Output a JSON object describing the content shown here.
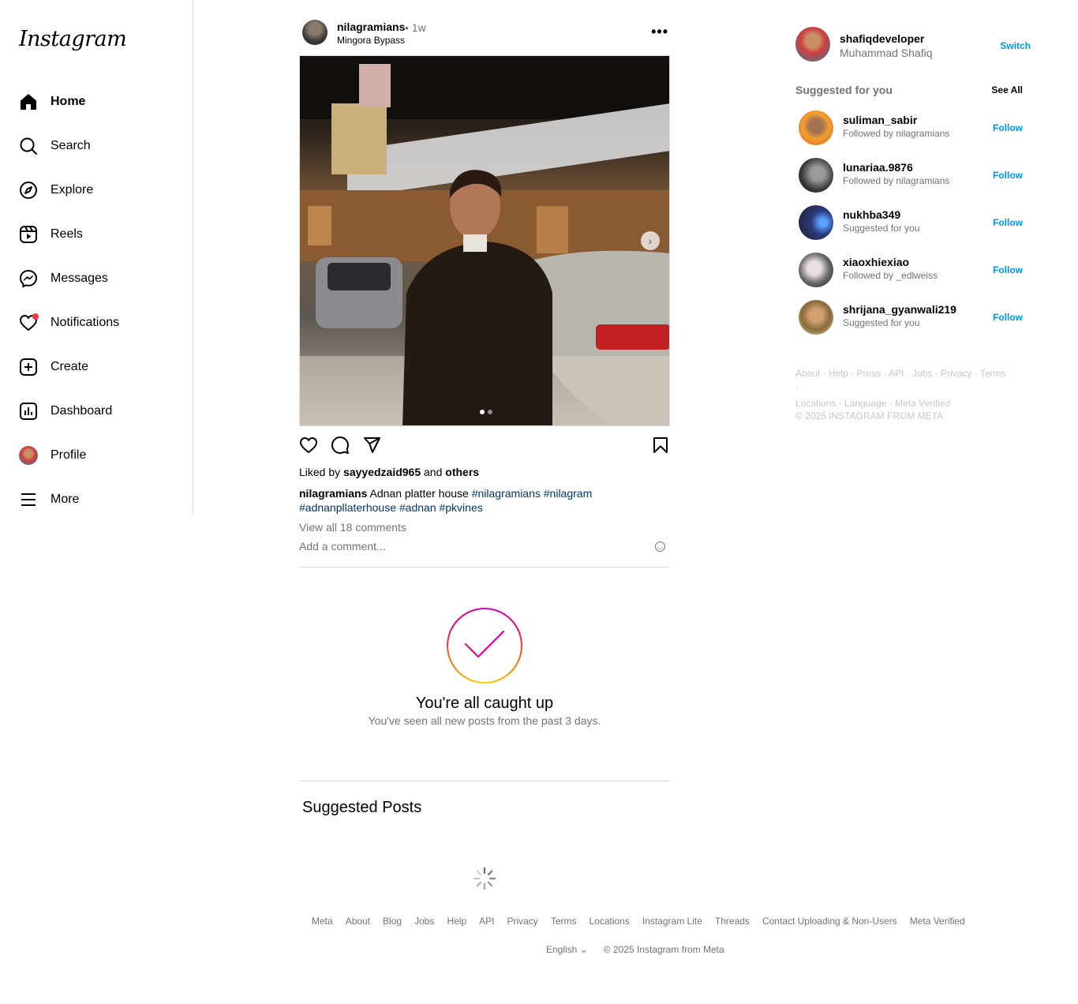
{
  "app": {
    "logo": "Instagram"
  },
  "nav": [
    {
      "label": "Home",
      "icon": "home-icon"
    },
    {
      "label": "Search",
      "icon": "search-icon"
    },
    {
      "label": "Explore",
      "icon": "compass-icon"
    },
    {
      "label": "Reels",
      "icon": "reels-icon"
    },
    {
      "label": "Messages",
      "icon": "messenger-icon"
    },
    {
      "label": "Notifications",
      "icon": "heart-icon"
    },
    {
      "label": "Create",
      "icon": "plus-square-icon"
    },
    {
      "label": "Dashboard",
      "icon": "chart-icon"
    },
    {
      "label": "Profile",
      "icon": "profile-avatar"
    },
    {
      "label": "More",
      "icon": "hamburger-icon"
    }
  ],
  "post": {
    "username": "nilagramians",
    "time": "• 1w",
    "location": "Mingora Bypass",
    "likes_prefix": "Liked by",
    "likes_user": "sayyedzaid965",
    "likes_and": "and",
    "likes_others": "others",
    "caption_user": "nilagramians",
    "caption_text": "Adnan platter house",
    "hashtags_line1": "#nilagramians #nilagram",
    "hashtags_line2": "#adnanpllaterhouse #adnan #pkvines",
    "view_comments": "View all 18 comments",
    "comment_placeholder": "Add a comment..."
  },
  "caught_up": {
    "title": "You're all caught up",
    "subtitle": "You've seen all new posts from the past 3 days."
  },
  "suggested_posts_title": "Suggested Posts",
  "footer": {
    "links": [
      "Meta",
      "About",
      "Blog",
      "Jobs",
      "Help",
      "API",
      "Privacy",
      "Terms",
      "Locations",
      "Instagram Lite",
      "Threads",
      "Contact Uploading & Non-Users",
      "Meta Verified"
    ],
    "language": "English",
    "copyright": "© 2025 Instagram from Meta"
  },
  "right": {
    "me_username": "shafiqdeveloper",
    "me_name": "Muhammad Shafiq",
    "switch": "Switch",
    "suggested_title": "Suggested for you",
    "see_all": "See All",
    "suggestions": [
      {
        "username": "suliman_sabir",
        "sub": "Followed by nilagramians",
        "action": "Follow"
      },
      {
        "username": "lunariaa.9876",
        "sub": "Followed by nilagramians",
        "action": "Follow"
      },
      {
        "username": "nukhba349",
        "sub": "Suggested for you",
        "action": "Follow"
      },
      {
        "username": "xiaoxhiexiao",
        "sub": "Followed by _edlweiss",
        "action": "Follow"
      },
      {
        "username": "shrijana_gyanwali219",
        "sub": "Suggested for you",
        "action": "Follow"
      }
    ],
    "links_line1": "About · Help · Press · API · Jobs · Privacy · Terms ·",
    "links_line2": "Locations · Language · Meta Verified",
    "copyright": "© 2025 INSTAGRAM FROM META"
  }
}
